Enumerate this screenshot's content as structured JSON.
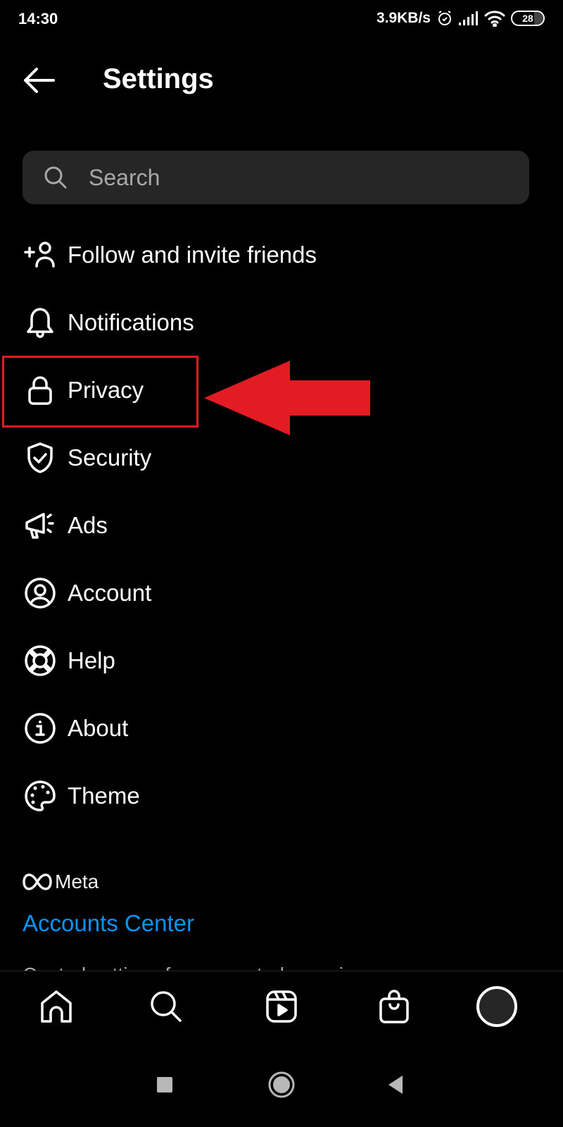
{
  "status_bar": {
    "time": "14:30",
    "net_speed": "3.9KB/s",
    "battery": "28",
    "icons": [
      "alarm-icon",
      "signal-icon",
      "wifi-icon",
      "battery-icon"
    ]
  },
  "header": {
    "title": "Settings",
    "back_icon": "arrow-left-icon"
  },
  "search": {
    "placeholder": "Search",
    "value": ""
  },
  "menu": {
    "items": [
      {
        "label": "Follow and invite friends",
        "icon": "add-person-icon"
      },
      {
        "label": "Notifications",
        "icon": "bell-icon"
      },
      {
        "label": "Privacy",
        "icon": "lock-icon"
      },
      {
        "label": "Security",
        "icon": "shield-check-icon"
      },
      {
        "label": "Ads",
        "icon": "megaphone-icon"
      },
      {
        "label": "Account",
        "icon": "user-circle-icon"
      },
      {
        "label": "Help",
        "icon": "lifebuoy-icon"
      },
      {
        "label": "About",
        "icon": "info-icon"
      },
      {
        "label": "Theme",
        "icon": "palette-icon"
      }
    ]
  },
  "annotation": {
    "highlighted_item": "Privacy",
    "color": "#e31b23"
  },
  "meta_section": {
    "brand": "Meta",
    "link": "Accounts Center",
    "description": "Control settings for connected experiences across",
    "link_color": "#0095f6"
  },
  "bottom_nav": {
    "items": [
      "home-icon",
      "search-icon",
      "reels-icon",
      "shop-icon",
      "profile-avatar"
    ]
  },
  "android_nav": {
    "items": [
      "recents-button",
      "home-button",
      "back-button"
    ]
  }
}
